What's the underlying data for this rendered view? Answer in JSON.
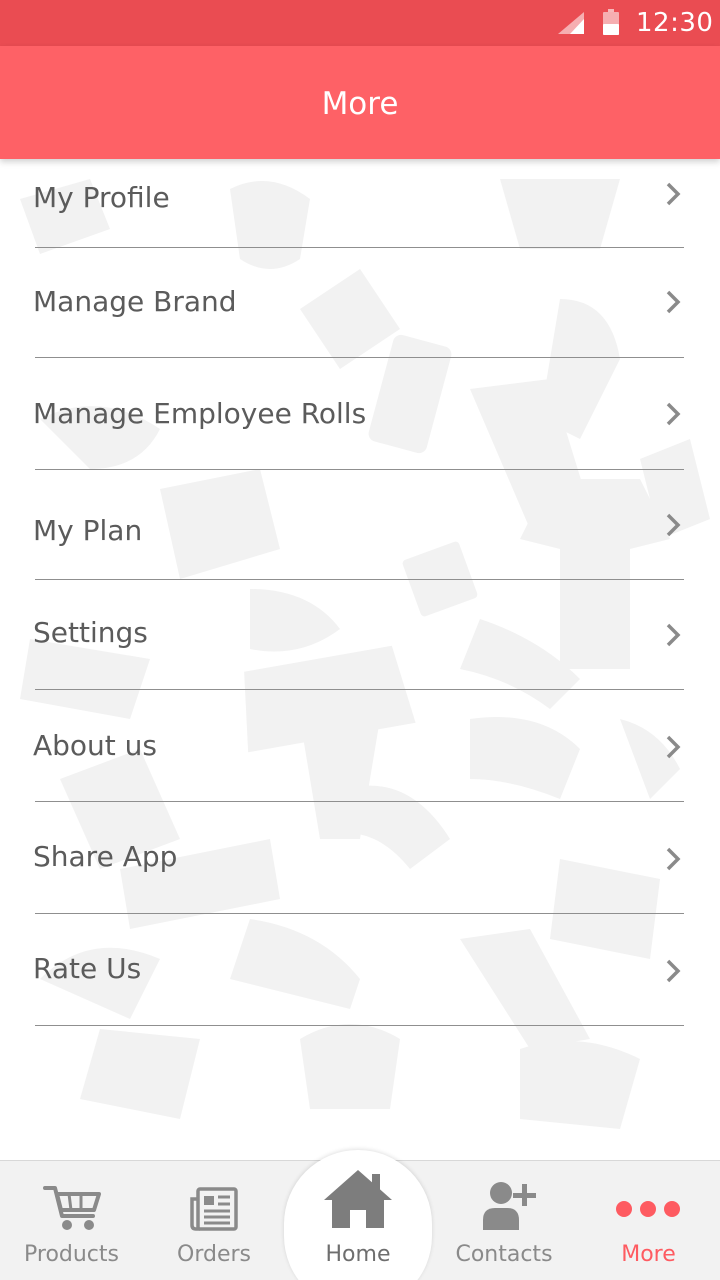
{
  "status_bar": {
    "time": "12:30"
  },
  "app_bar": {
    "title": "More"
  },
  "menu": {
    "items": [
      {
        "label": "My Profile"
      },
      {
        "label": "Manage Brand"
      },
      {
        "label": "Manage Employee Rolls"
      },
      {
        "label": "My Plan"
      },
      {
        "label": "Settings"
      },
      {
        "label": "About us"
      },
      {
        "label": "Share App"
      },
      {
        "label": "Rate Us"
      }
    ]
  },
  "bottom_nav": {
    "items": [
      {
        "label": "Products",
        "icon": "cart-icon"
      },
      {
        "label": "Orders",
        "icon": "newspaper-icon"
      },
      {
        "label": "Home",
        "icon": "home-icon"
      },
      {
        "label": "Contacts",
        "icon": "add-contact-icon"
      },
      {
        "label": "More",
        "icon": "more-dots-icon",
        "active": true
      }
    ]
  },
  "colors": {
    "status_bar": "#ea4c52",
    "app_bar": "#fe6166",
    "accent": "#fe5b61",
    "text": "#5b5b5b",
    "nav_inactive": "#8a8a8a"
  }
}
